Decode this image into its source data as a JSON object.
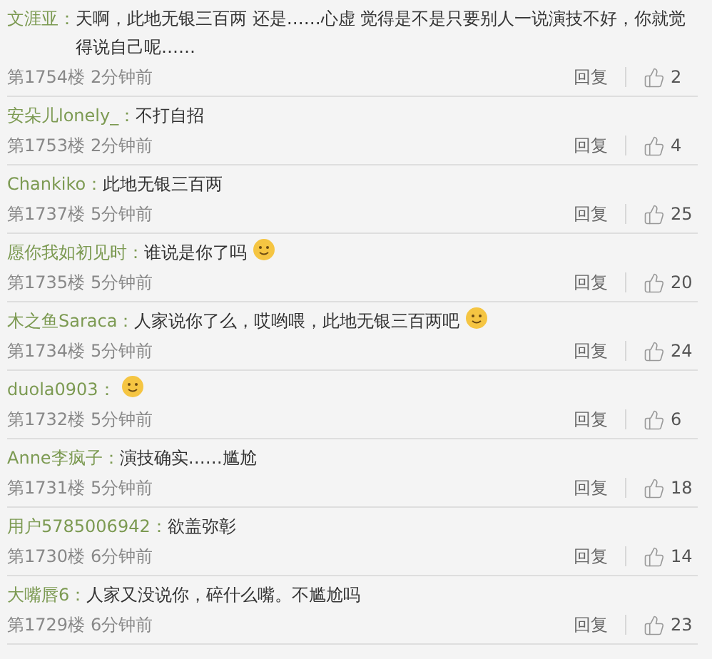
{
  "comments": [
    {
      "user": "文涯亚：",
      "text": "天啊，此地无银三百两 还是……心虚 觉得是不是只要别人一说演技不好，你就觉得说自己呢……",
      "emoji": false,
      "floor": "第1754楼",
      "time": "2分钟前",
      "reply": "回复",
      "likes": "2"
    },
    {
      "user": "安朵儿lonely_：",
      "text": "不打自招",
      "emoji": false,
      "floor": "第1753楼",
      "time": "2分钟前",
      "reply": "回复",
      "likes": "4"
    },
    {
      "user": "Chankiko：",
      "text": "此地无银三百两",
      "emoji": false,
      "floor": "第1737楼",
      "time": "5分钟前",
      "reply": "回复",
      "likes": "25"
    },
    {
      "user": "愿你我如初见时：",
      "text": "谁说是你了吗",
      "emoji": true,
      "floor": "第1735楼",
      "time": "5分钟前",
      "reply": "回复",
      "likes": "20"
    },
    {
      "user": "木之鱼Saraca：",
      "text": "人家说你了么，哎哟喂，此地无银三百两吧",
      "emoji": true,
      "floor": "第1734楼",
      "time": "5分钟前",
      "reply": "回复",
      "likes": "24"
    },
    {
      "user": "duola0903：",
      "emoji": true,
      "floor": "第1732楼",
      "time": "5分钟前",
      "reply": "回复",
      "likes": "6"
    },
    {
      "user": "Anne李疯子：",
      "text": "演技确实……尴尬",
      "emoji": false,
      "floor": "第1731楼",
      "time": "5分钟前",
      "reply": "回复",
      "likes": "18"
    },
    {
      "user": "用户5785006942：",
      "text": "欲盖弥彰",
      "emoji": false,
      "floor": "第1730楼",
      "time": "6分钟前",
      "reply": "回复",
      "likes": "14"
    },
    {
      "user": "大嘴唇6：",
      "text": "人家又没说你，碎什么嘴。不尴尬吗",
      "emoji": false,
      "floor": "第1729楼",
      "time": "6分钟前",
      "reply": "回复",
      "likes": "23"
    }
  ]
}
